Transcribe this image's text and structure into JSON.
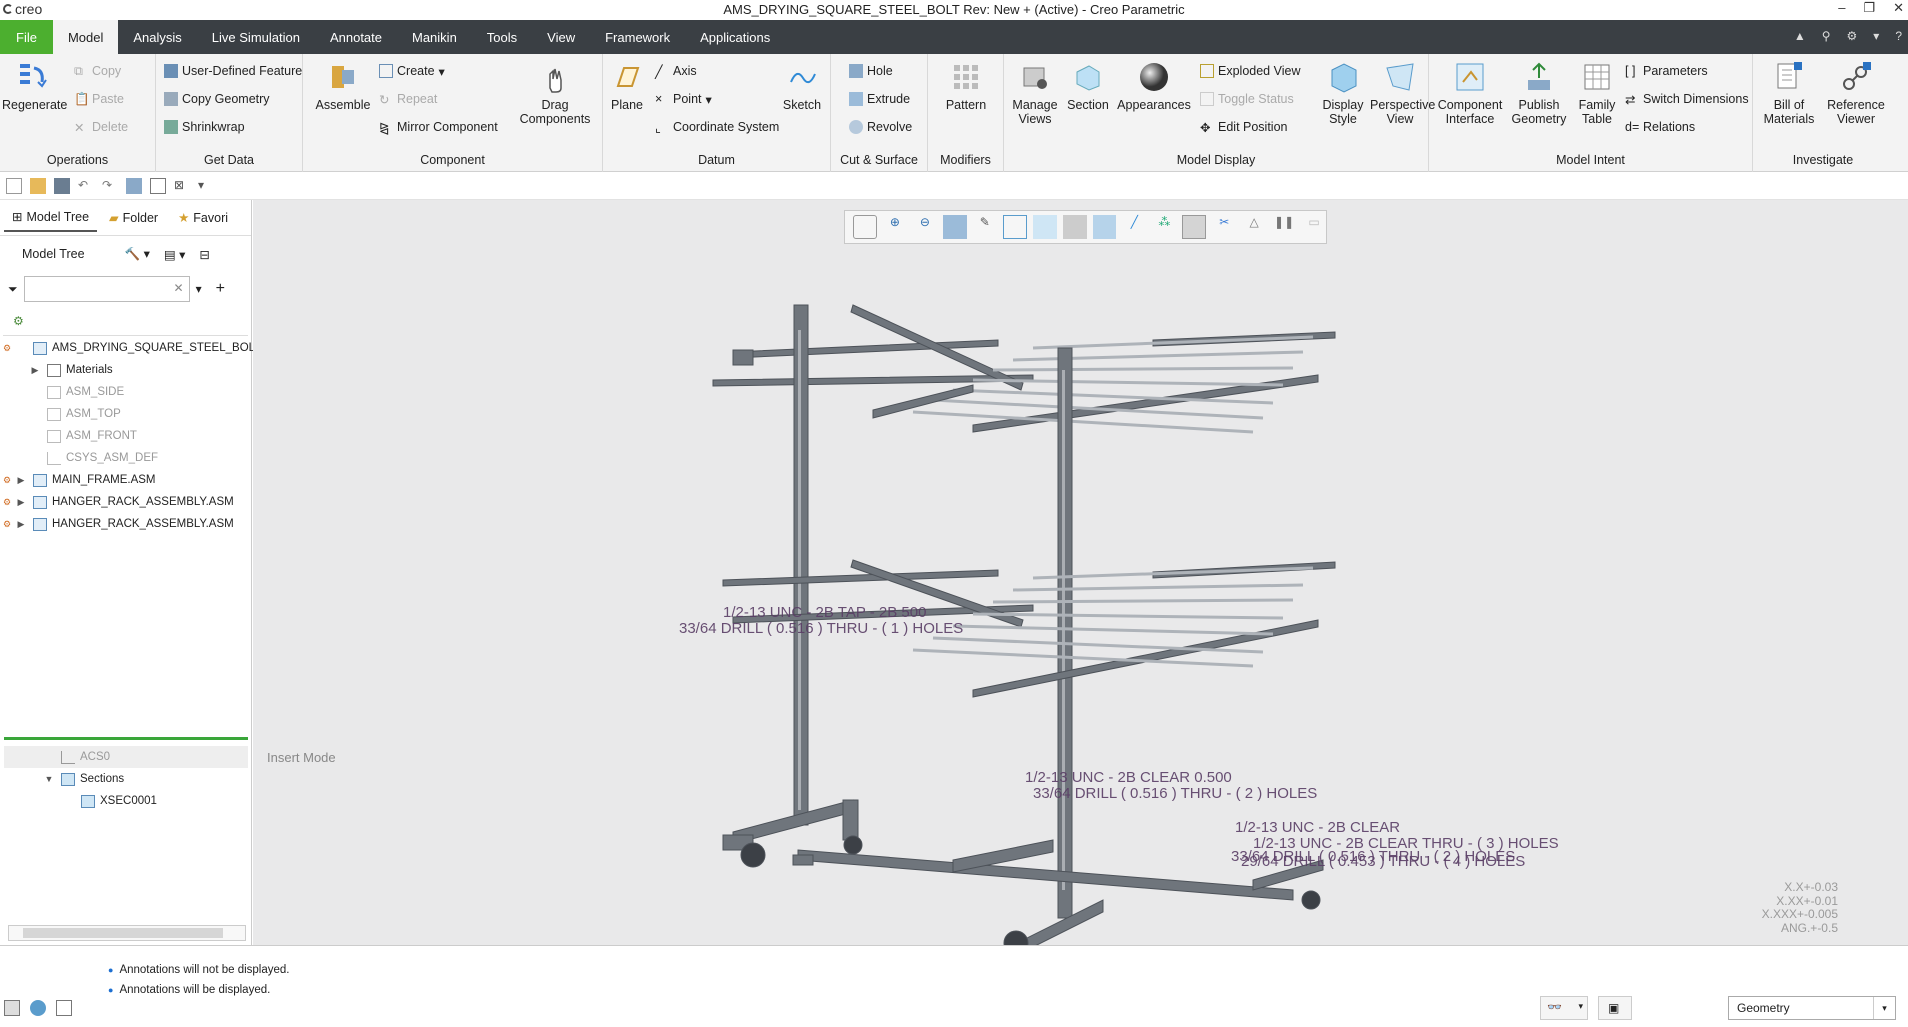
{
  "app": {
    "logo_text": "creo",
    "window_title": "AMS_DRYING_SQUARE_STEEL_BOLT Rev: New + (Active) - Creo Parametric"
  },
  "menu_tabs": [
    "File",
    "Model",
    "Analysis",
    "Live Simulation",
    "Annotate",
    "Manikin",
    "Tools",
    "View",
    "Framework",
    "Applications"
  ],
  "ribbon": {
    "operations": {
      "regenerate": "Regenerate",
      "copy": "Copy",
      "paste": "Paste",
      "delete": "Delete",
      "label": "Operations"
    },
    "get_data": {
      "udf": "User-Defined Feature",
      "copy_geometry": "Copy Geometry",
      "shrinkwrap": "Shrinkwrap",
      "label": "Get Data"
    },
    "component": {
      "assemble": "Assemble",
      "create": "Create",
      "repeat": "Repeat",
      "mirror": "Mirror Component",
      "drag_1": "Drag",
      "drag_2": "Components",
      "label": "Component"
    },
    "datum": {
      "plane": "Plane",
      "axis": "Axis",
      "point": "Point",
      "csys": "Coordinate System",
      "sketch": "Sketch",
      "label": "Datum"
    },
    "cut_surface": {
      "hole": "Hole",
      "extrude": "Extrude",
      "revolve": "Revolve",
      "label": "Cut & Surface"
    },
    "modifiers": {
      "pattern": "Pattern",
      "label": "Modifiers"
    },
    "model_display": {
      "manage_views_1": "Manage",
      "manage_views_2": "Views",
      "section": "Section",
      "appearances": "Appearances",
      "exploded": "Exploded View",
      "toggle_status": "Toggle Status",
      "edit_position": "Edit Position",
      "display_style_1": "Display",
      "display_style_2": "Style",
      "perspective_1": "Perspective",
      "perspective_2": "View",
      "label": "Model Display"
    },
    "model_intent": {
      "component_interface_1": "Component",
      "component_interface_2": "Interface",
      "publish_1": "Publish",
      "publish_2": "Geometry",
      "family_1": "Family",
      "family_2": "Table",
      "parameters": "Parameters",
      "switch_dims": "Switch Dimensions",
      "relations": "Relations",
      "label": "Model Intent"
    },
    "investigate": {
      "bom_1": "Bill of",
      "bom_2": "Materials",
      "refviewer_1": "Reference",
      "refviewer_2": "Viewer",
      "label": "Investigate"
    }
  },
  "left_panel": {
    "tabs": [
      "Model Tree",
      "Folder",
      "Favori"
    ],
    "header": "Model Tree",
    "tree": [
      {
        "label": "AMS_DRYING_SQUARE_STEEL_BOLT.AS",
        "gray": false
      },
      {
        "label": "Materials",
        "gray": false
      },
      {
        "label": "ASM_SIDE",
        "gray": true
      },
      {
        "label": "ASM_TOP",
        "gray": true
      },
      {
        "label": "ASM_FRONT",
        "gray": true
      },
      {
        "label": "CSYS_ASM_DEF",
        "gray": true
      },
      {
        "label": "MAIN_FRAME.ASM",
        "gray": false
      },
      {
        "label": "HANGER_RACK_ASSEMBLY.ASM",
        "gray": false
      },
      {
        "label": "HANGER_RACK_ASSEMBLY.ASM",
        "gray": false
      },
      {
        "label": "ACS0",
        "gray": false
      },
      {
        "label": "Sections",
        "gray": false
      },
      {
        "label": "XSEC0001",
        "gray": false
      }
    ]
  },
  "viewport": {
    "insert_mode": "Insert Mode",
    "tolerances": [
      "X.X+-0.03",
      "X.XX+-0.01",
      "X.XXX+-0.005",
      "ANG.+-0.5"
    ],
    "annotations": [
      "1/2-13 UNC - 2B TAP - 2B 500",
      "33/64 DRILL ( 0.516 ) THRU - ( 1 ) HOLES",
      "1/2-13 UNC - 2B CLEAR 0.500",
      "33/64 DRILL ( 0.516 ) THRU - ( 2 ) HOLES",
      "1/2-13 UNC - 2B CLEAR",
      "1/2-13 UNC - 2B CLEAR THRU - ( 3 ) HOLES",
      "33/64 DRILL ( 0.516 ) THRU - ( 2 ) HOLES",
      "29/64 DRILL ( 0.453 ) THRU - ( 4 ) HOLES"
    ]
  },
  "status": {
    "messages": [
      "Annotations will not be displayed.",
      "Annotations will be displayed."
    ],
    "filter_value": "Geometry"
  },
  "colors": {
    "file_tab": "#4caf2f",
    "tabbar": "#3a3f44",
    "viewport_bg": "#e9e9ea",
    "annotation": "#5a3e66"
  }
}
